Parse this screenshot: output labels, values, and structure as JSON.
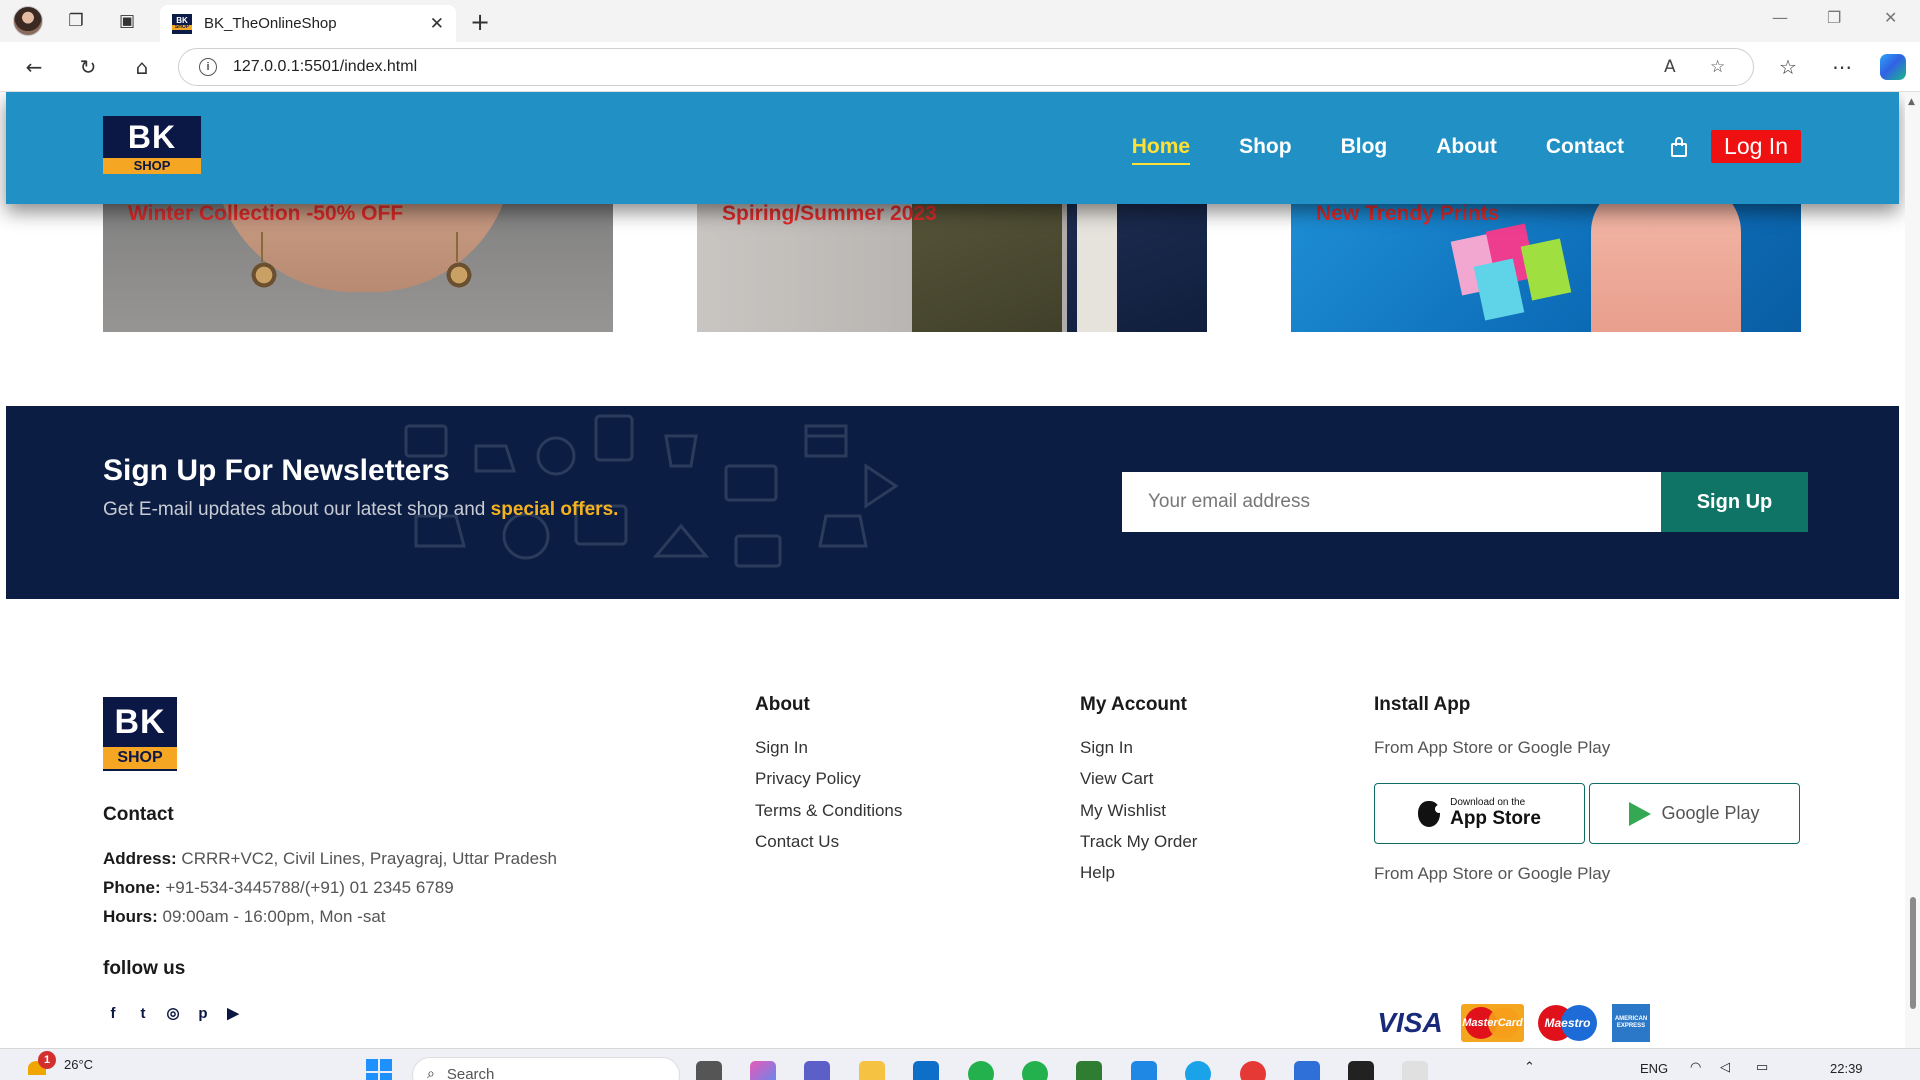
{
  "browser": {
    "tab_title": "BK_TheOnlineShop",
    "url": "127.0.0.1:5501/index.html",
    "new_tab_glyph": "+",
    "tab_close_glyph": "✕",
    "read_aloud_label": "A",
    "icons": [
      "profile-avatar",
      "workspaces-icon",
      "tab-actions-icon",
      "back-icon",
      "reload-icon",
      "home-icon",
      "site-info-icon",
      "read-aloud-icon",
      "favorite-icon",
      "favorites-icon",
      "more-icon",
      "copilot-icon"
    ]
  },
  "header": {
    "logo_top": "BK",
    "logo_bottom": "SHOP",
    "nav": [
      "Home",
      "Shop",
      "Blog",
      "About",
      "Contact"
    ],
    "active_nav": "Home",
    "login": "Log In",
    "cart_icon": "shopping-bag-icon",
    "colors": {
      "bar": "#2190c5",
      "active": "#ffe135",
      "login_bg": "#ef1111"
    }
  },
  "banners": [
    {
      "caption": "Winter Collection -50% OFF"
    },
    {
      "caption": "Spiring/Summer 2023"
    },
    {
      "caption": "New Trendy Prints"
    }
  ],
  "newsletter": {
    "title": "Sign Up For Newsletters",
    "subtitle": "Get E-mail updates about our latest shop and",
    "highlight": "special offers.",
    "placeholder": "Your email address",
    "button": "Sign Up",
    "colors": {
      "bg": "#0b1d42",
      "button": "#0f7466",
      "highlight": "#f5b21f"
    }
  },
  "footer": {
    "logo_top": "BK",
    "logo_bottom": "SHOP",
    "contact": {
      "title": "Contact",
      "address_label": "Address:",
      "address": "CRRR+VC2, Civil Lines, Prayagraj, Uttar Pradesh",
      "phone_label": "Phone:",
      "phone": "+91-534-3445788/(+91) 01 2345 6789",
      "hours_label": "Hours:",
      "hours": "09:00am - 16:00pm, Mon -sat"
    },
    "follow": {
      "title": "follow us",
      "icons": [
        "facebook-icon",
        "twitter-icon",
        "instagram-icon",
        "pinterest-icon",
        "youtube-icon"
      ],
      "glyphs": [
        "f",
        "t",
        "◎",
        "p",
        "▶"
      ]
    },
    "about": {
      "title": "About",
      "links": [
        "Sign In",
        "Privacy Policy",
        "Terms & Conditions",
        "Contact Us"
      ]
    },
    "account": {
      "title": "My Account",
      "links": [
        "Sign In",
        "View Cart",
        "My Wishlist",
        "Track My Order",
        "Help"
      ]
    },
    "install": {
      "title": "Install App",
      "line1": "From App Store or Google Play",
      "line2": "From App Store or Google Play",
      "appstore_small": "Download on the",
      "appstore_big": "App Store",
      "googleplay": "Google Play",
      "payments": {
        "visa": "VISA",
        "mastercard": "MasterCard",
        "maestro": "Maestro",
        "amex": "AMERICAN EXPRESS"
      }
    }
  },
  "taskbar": {
    "weather_badge": "1",
    "temperature": "26°C",
    "search_placeholder": "Search",
    "language": "ENG",
    "time": "22:39"
  }
}
